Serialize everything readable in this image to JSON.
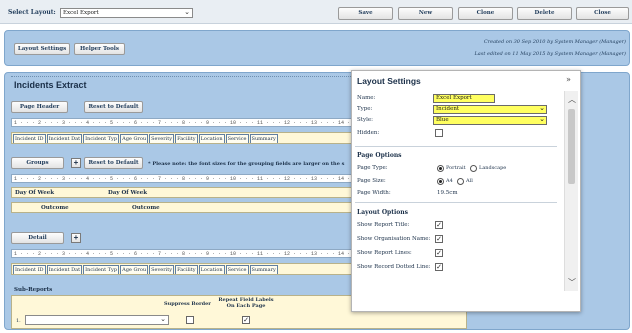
{
  "topbar": {
    "select_layout_label": "Select Layout:",
    "select_layout_value": "Excel Export",
    "buttons": [
      "Save",
      "New",
      "Clone",
      "Delete",
      "Close"
    ]
  },
  "toolbar": {
    "layout_settings": "Layout Settings",
    "helper_tools": "Helper Tools",
    "created": "Created on 30 Sep 2010 by System Manager (Manager)",
    "edited": "Last edited on 11 May 2015 by System Manager (Manager)"
  },
  "report": {
    "title": "Incidents Extract",
    "page_header": {
      "label": "Page Header",
      "reset": "Reset to Default",
      "ruler": "1 · · · 2 · · · 3 · · · 4 · · · 5 · · · 6 · · · 7 · · · 8 · · · 9 · · · 10 · · · 11 · · · 12 · · · 13 · · · 14 · · ·",
      "fields": [
        "Incident ID",
        "Incident Dat",
        "Incident Typ",
        "Age Grou",
        "Severity",
        "Facility",
        "Location",
        "Service",
        "Summary"
      ]
    },
    "groups": {
      "label": "Groups",
      "reset": "Reset to Default",
      "note": "* Please note: the font sizes for the grouping fields are larger on the s",
      "ruler": "1 · · · 2 · · · 3 · · · 4 · · · 5 · · · 6 · · · 7 · · · 8 · · · 9 · · · 10 · · · 11 · · · 12 · · · 13 · · · 14 · · ·",
      "row1": [
        "Day Of Week",
        "Day Of Week"
      ],
      "row2": [
        "Outcome",
        "Outcome"
      ]
    },
    "detail": {
      "label": "Detail",
      "ruler": "1 · · · 2 · · · 3 · · · 4 · · · 5 · · · 6 · · · 7 · · · 8 · · · 9 · · · 10 · · · 11 · · · 12 · · · 13 · · · 14 · · ·",
      "fields": [
        "Incident ID",
        "Incident Dat",
        "Incident Typ",
        "Age Grou",
        "Severity",
        "Facility",
        "Location",
        "Service",
        "Summary"
      ]
    },
    "subreports": {
      "label": "Sub-Reports",
      "suppress_border": "Suppress Border",
      "repeat_labels": "Repeat Field Labels On Each Page",
      "row_number": "1."
    }
  },
  "layout_settings": {
    "title": "Layout Settings",
    "name_label": "Name:",
    "name_value": "Excel Export",
    "type_label": "Type:",
    "type_value": "Incident",
    "style_label": "Style:",
    "style_value": "Blue",
    "hidden_label": "Hidden:",
    "page_options_title": "Page Options",
    "page_type_label": "Page Type:",
    "portrait": "Portrait",
    "landscape": "Landscape",
    "page_size_label": "Page Size:",
    "a4": "A4",
    "all": "All",
    "page_width_label": "Page Width:",
    "page_width_value": "19.5cm",
    "layout_options_title": "Layout Options",
    "options": [
      "Show Report Title:",
      "Show Organisation Name:",
      "Show Report Lines:",
      "Show Record Dotted Line:"
    ]
  },
  "icons": {
    "chevron": "chevron-down-icon",
    "collapse": "double-chevron-icon",
    "check": "checkmark-icon",
    "plus": "plus-icon"
  }
}
